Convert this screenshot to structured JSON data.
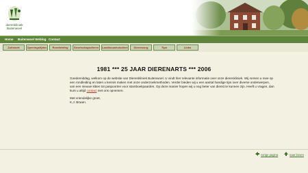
{
  "site": {
    "logo_text_line1": "dierenkliniek",
    "logo_text_line2": "Buitenwoel",
    "colors": {
      "nav_green": "#5d8439",
      "tab_text": "#a12a1a",
      "link": "#b2331f",
      "page_bg": "#f3f1e2"
    }
  },
  "topnav": {
    "items": [
      "Home",
      "Buitenwoel Weblog",
      "Contact"
    ]
  },
  "tabs": {
    "items": [
      "Zuilstoek",
      "Openingstijden",
      "Rondleiding",
      "Gezelschapsdieren",
      "Landbouwhuisdieren",
      "Dierenzorg",
      "Tips",
      "Links"
    ]
  },
  "main": {
    "title": "1981 *** 25 JAAR DIERENARTS *** 2006",
    "intro_before_link": "Goedemiddag, welkom op de website van Dierenkliniek Buitenwoel. U vindt hier relevante informatie over onze dierenkliniek. Wij nemen u mee op een rondleiding en laten u kennis maken met onze onderzoekmethoden. Verder bieden wij u een aantal handige tips over diverse onderwerpen, van een nieuwe kitten tot paspoorten voor stamboekpaarden. Op deze manier hopen wij u nog beter van dienst te kunnen zijn. Heeft u vragen, dan kunt u altijd ",
    "intro_link": "contact",
    "intro_after_link": " met ons opnemen.",
    "greeting_line1": "Met vriendelijke groet,",
    "greeting_line2": "K.J. Braam."
  },
  "footer": {
    "prev_label": "vorige pagina",
    "next_label": "naar boven",
    "icons": [
      "back-arrow-icon",
      "up-arrow-icon"
    ]
  }
}
